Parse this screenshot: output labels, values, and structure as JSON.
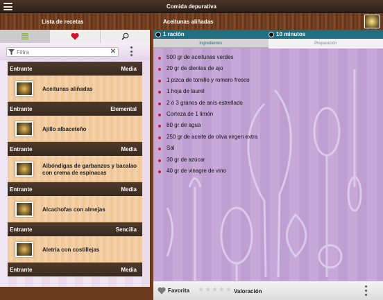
{
  "app": {
    "title": "Comida depurativa"
  },
  "left_panel": {
    "title": "Lista de recetas",
    "filter_placeholder": "Filtra"
  },
  "recipes": [
    {
      "category": "Entrante",
      "difficulty": "Media",
      "name": "Aceitunas aliñadas"
    },
    {
      "category": "Entrante",
      "difficulty": "Elemental",
      "name": "Ajillo albaceteño"
    },
    {
      "category": "Entrante",
      "difficulty": "Media",
      "name": "Albóndigas de garbanzos y bacalao con crema de espinacas"
    },
    {
      "category": "Entrante",
      "difficulty": "Media",
      "name": "Alcachofas con almejas"
    },
    {
      "category": "Entrante",
      "difficulty": "Sencilla",
      "name": "Aletría con costillejas"
    },
    {
      "category": "Entrante",
      "difficulty": "Media",
      "name": ""
    }
  ],
  "recipe": {
    "title": "Aceitunas aliñadas",
    "servings": "1 ración",
    "time": "10 minutos",
    "tabs": [
      "Ingredientes",
      "Preparación"
    ],
    "ingredients": [
      "500 gr de aceitunas verdes",
      "20 gr de dientes de ajo",
      "1 pizca de tomillo y romero fresco",
      "1 hoja de laurel",
      "2 ó 3 granos de anís estrellado",
      "Corteza de 1 limón",
      "80 gr de agua",
      "250 gr de aceite de oliva virgen extra",
      "Sal",
      "30 gr de azúcar",
      "40 gr de vinagre de vino"
    ]
  },
  "bottom": {
    "favorite": "Favorita",
    "rating_label": "Valoración",
    "rating": 0,
    "rating_max": 5
  },
  "colors": {
    "accent": "#1f6f80",
    "bullet": "#c51f36",
    "heart": "#d0102a"
  },
  "icons": [
    "menu-icon",
    "list-icon",
    "heart-icon",
    "search-icon",
    "filter-icon",
    "clear-icon",
    "more-icon",
    "people-icon",
    "clock-icon",
    "star-icon"
  ]
}
